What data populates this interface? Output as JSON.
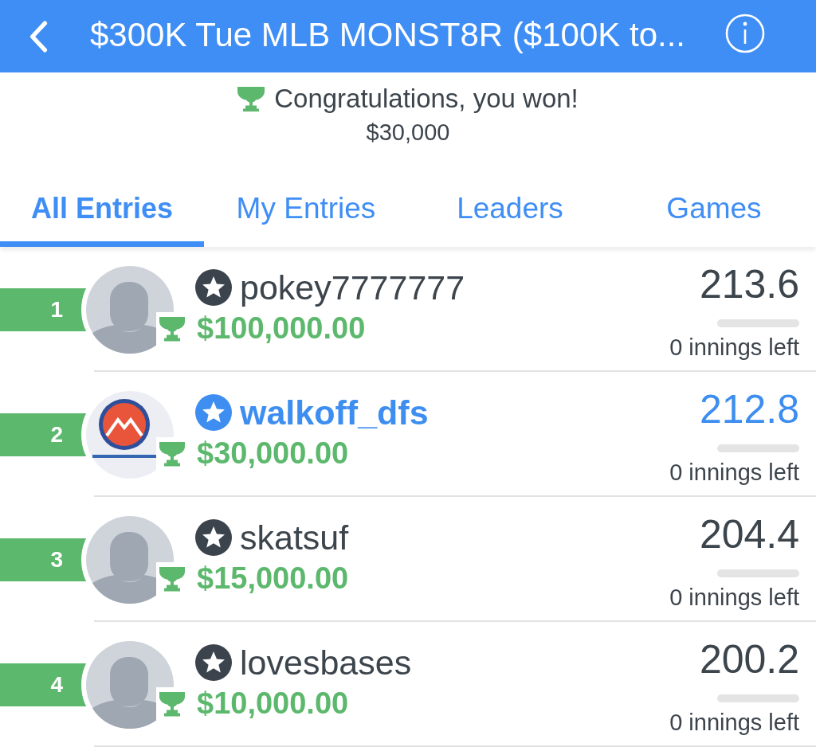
{
  "header": {
    "title": "$300K Tue MLB MONST8R ($100K to..."
  },
  "result": {
    "message": "Congratulations, you won!",
    "amount": "$30,000"
  },
  "tabs": [
    {
      "label": "All Entries",
      "selected": true
    },
    {
      "label": "My Entries",
      "selected": false
    },
    {
      "label": "Leaders",
      "selected": false
    },
    {
      "label": "Games",
      "selected": false
    }
  ],
  "entries": [
    {
      "rank": "1",
      "avatar": {
        "kind": "silhouette"
      },
      "won": true,
      "username": "pokey7777777",
      "own_entry": false,
      "prize": "$100,000.00",
      "score": "213.6",
      "level": 0,
      "remaining": "0 innings left"
    },
    {
      "rank": "2",
      "avatar": {
        "kind": "logo"
      },
      "won": true,
      "username": "walkoff_dfs",
      "own_entry": true,
      "prize": "$30,000.00",
      "score": "212.8",
      "level": 0,
      "remaining": "0 innings left"
    },
    {
      "rank": "3",
      "avatar": {
        "kind": "silhouette"
      },
      "won": true,
      "username": "skatsuf",
      "own_entry": false,
      "prize": "$15,000.00",
      "score": "204.4",
      "level": 0,
      "remaining": "0 innings left"
    },
    {
      "rank": "4",
      "avatar": {
        "kind": "silhouette"
      },
      "won": true,
      "username": "lovesbases",
      "own_entry": false,
      "prize": "$10,000.00",
      "score": "200.2",
      "level": 0,
      "remaining": "0 innings left"
    }
  ]
}
